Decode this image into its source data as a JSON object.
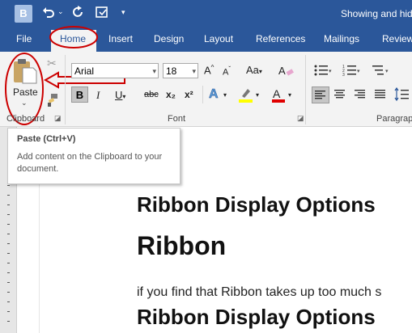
{
  "titlebar": {
    "app_icon_letter": "B",
    "title": "Showing and hid"
  },
  "tabs": [
    "File",
    "Home",
    "Insert",
    "Design",
    "Layout",
    "References",
    "Mailings",
    "Review"
  ],
  "font": {
    "name": "Arial",
    "size": "18"
  },
  "clipboard": {
    "paste_label": "Paste",
    "group_label": "Clipboard"
  },
  "groups": {
    "font": "Font",
    "paragraph": "Paragrap"
  },
  "format_buttons": [
    "B",
    "I",
    "U",
    "abc",
    "x₂",
    "x²"
  ],
  "tooltip": {
    "title": "Paste (Ctrl+V)",
    "body": "Add content on the Clipboard to your document."
  },
  "document": {
    "heading1": "Ribbon Display Options",
    "heading2": "Ribbon",
    "paragraph": "if you find that Ribbon takes up too much s",
    "heading3": "Ribbon Display Options"
  },
  "colors": {
    "brand": "#2b579a",
    "annotation_red": "#cc0000",
    "highlight_yellow": "#ffff00",
    "font_color_red": "#e00000"
  }
}
